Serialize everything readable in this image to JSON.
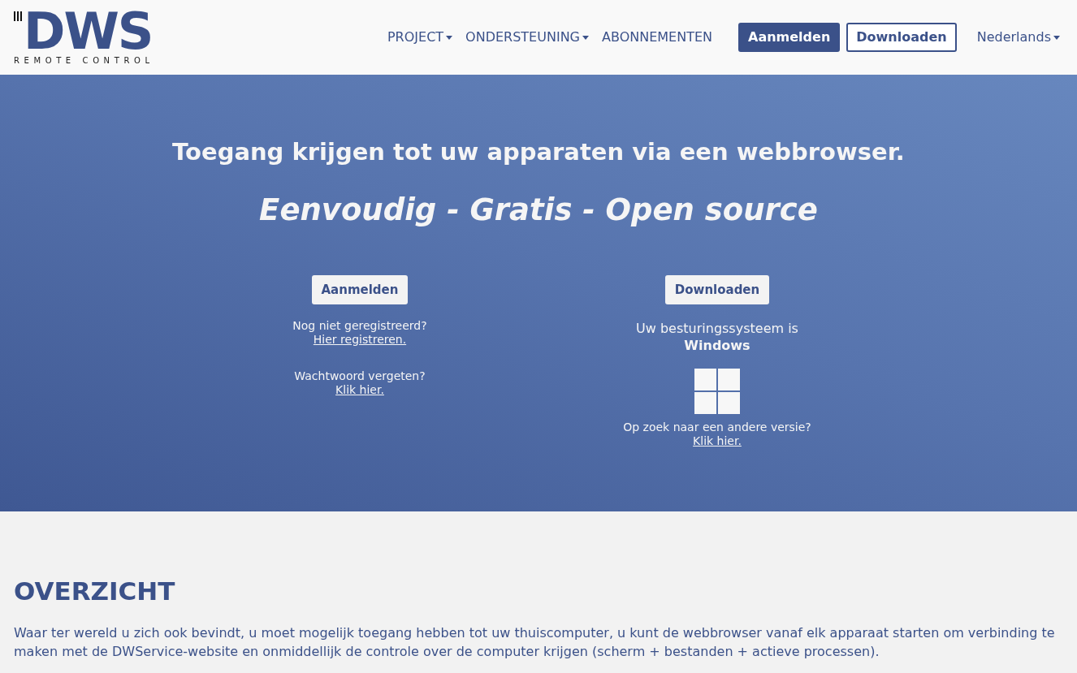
{
  "header": {
    "logo": {
      "mark": "DWS",
      "tagline": "REMOTE CONTROL"
    },
    "nav": [
      {
        "label": "PROJECT",
        "dropdown": true
      },
      {
        "label": "ONDERSTEUNING",
        "dropdown": true
      },
      {
        "label": "ABONNEMENTEN",
        "dropdown": false
      }
    ],
    "buttons": [
      {
        "label": "Aanmelden",
        "kind": "filled"
      },
      {
        "label": "Downloaden",
        "kind": "outline"
      }
    ],
    "language": {
      "label": "Nederlands",
      "dropdown": true
    }
  },
  "hero": {
    "title": "Toegang krijgen tot uw apparaten via een webbrowser.",
    "subtitle": "Eenvoudig - Gratis - Open source",
    "login": {
      "button": "Aanmelden",
      "blocks": [
        {
          "text": "Nog niet geregistreerd?",
          "link": "Hier registreren."
        },
        {
          "text": "Wachtwoord vergeten?",
          "link": "Klik hier."
        }
      ]
    },
    "download": {
      "button": "Downloaden",
      "os_label": "Uw besturingssysteem is",
      "os_name": "Windows",
      "other_text": "Op zoek naar een andere versie?",
      "other_link": "Klik hier."
    }
  },
  "overview": {
    "heading": "OVERZICHT",
    "text": "Waar ter wereld u zich ook bevindt, u moet mogelijk toegang hebben tot uw thuiscomputer, u kunt de webbrowser vanaf elk apparaat starten om verbinding te maken met de DWService-website en onmiddellijk de controle over de computer krijgen (scherm + bestanden + actieve processen)."
  }
}
